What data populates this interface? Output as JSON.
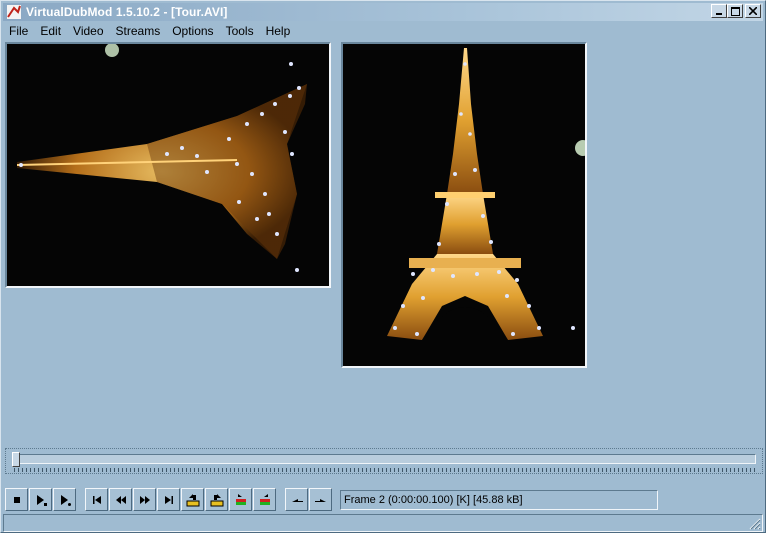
{
  "window": {
    "title": "VirtualDubMod 1.5.10.2 - [Tour.AVI]",
    "controls": [
      "minimize",
      "maximize",
      "close"
    ]
  },
  "menu": [
    "File",
    "Edit",
    "Video",
    "Streams",
    "Options",
    "Tools",
    "Help"
  ],
  "panes": {
    "input_label": "input-video-pane",
    "output_label": "output-video-pane"
  },
  "timeline": {
    "position_fraction": 0.0
  },
  "toolbar": {
    "buttons": [
      {
        "name": "stop-icon",
        "group": 1
      },
      {
        "name": "play-input-icon",
        "group": 1
      },
      {
        "name": "play-output-icon",
        "group": 1
      },
      {
        "name": "go-start-icon",
        "group": 2
      },
      {
        "name": "step-back-icon",
        "group": 2
      },
      {
        "name": "step-forward-icon",
        "group": 2
      },
      {
        "name": "go-end-icon",
        "group": 2
      },
      {
        "name": "prev-keyframe-icon",
        "group": 2
      },
      {
        "name": "next-keyframe-icon",
        "group": 2
      },
      {
        "name": "prev-scene-icon",
        "group": 2
      },
      {
        "name": "next-scene-icon",
        "group": 2
      },
      {
        "name": "mark-in-icon",
        "group": 3
      },
      {
        "name": "mark-out-icon",
        "group": 3
      }
    ]
  },
  "status": {
    "frame_info": "Frame 2 (0:00:00.100) [K] [45.88 kB]"
  },
  "colors": {
    "background": "#9fbbd1",
    "title_text": "#ffffff",
    "tower_light": "#e0a030"
  }
}
